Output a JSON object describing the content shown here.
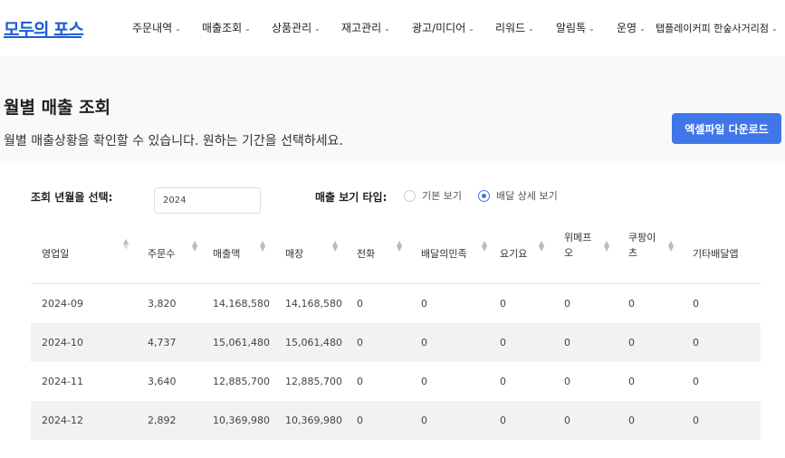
{
  "brand": {
    "logo_text": "모두의 포스",
    "accent_color": "#1c5bd6",
    "button_color": "#3f76e8"
  },
  "nav": {
    "items": [
      {
        "label": "주문내역"
      },
      {
        "label": "매출조회"
      },
      {
        "label": "상품관리"
      },
      {
        "label": "재고관리"
      },
      {
        "label": "광고/미디어"
      },
      {
        "label": "리워드"
      },
      {
        "label": "알림톡"
      },
      {
        "label": "운영"
      }
    ],
    "store": {
      "label": "탭플레이커피 한숲사거리점"
    },
    "chevron_icon": "chevron-down-icon"
  },
  "page": {
    "title": "월별 매출 조회",
    "description": "월별 매출상황을 확인할 수 있습니다. 원하는 기간을 선택하세요.",
    "excel_button": "엑셀파일 다운로드"
  },
  "filters": {
    "year_label": "조회 년월을 선택:",
    "year_value": "2024",
    "view_type_label": "매출 보기 타입:",
    "options": [
      {
        "label": "기본 보기",
        "selected": false
      },
      {
        "label": "배달 상세 보기",
        "selected": true
      }
    ]
  },
  "table": {
    "headers": [
      "영업일",
      "주문수",
      "매출액",
      "매장",
      "전화",
      "배달의민족",
      "요기요",
      "위메프\n오",
      "쿠팡이\n츠",
      "기타배달앱"
    ],
    "rows": [
      [
        "2024-09",
        "3,820",
        "14,168,580",
        "14,168,580",
        "0",
        "0",
        "0",
        "0",
        "0",
        "0"
      ],
      [
        "2024-10",
        "4,737",
        "15,061,480",
        "15,061,480",
        "0",
        "0",
        "0",
        "0",
        "0",
        "0"
      ],
      [
        "2024-11",
        "3,640",
        "12,885,700",
        "12,885,700",
        "0",
        "0",
        "0",
        "0",
        "0",
        "0"
      ],
      [
        "2024-12",
        "2,892",
        "10,369,980",
        "10,369,980",
        "0",
        "0",
        "0",
        "0",
        "0",
        "0"
      ]
    ]
  }
}
